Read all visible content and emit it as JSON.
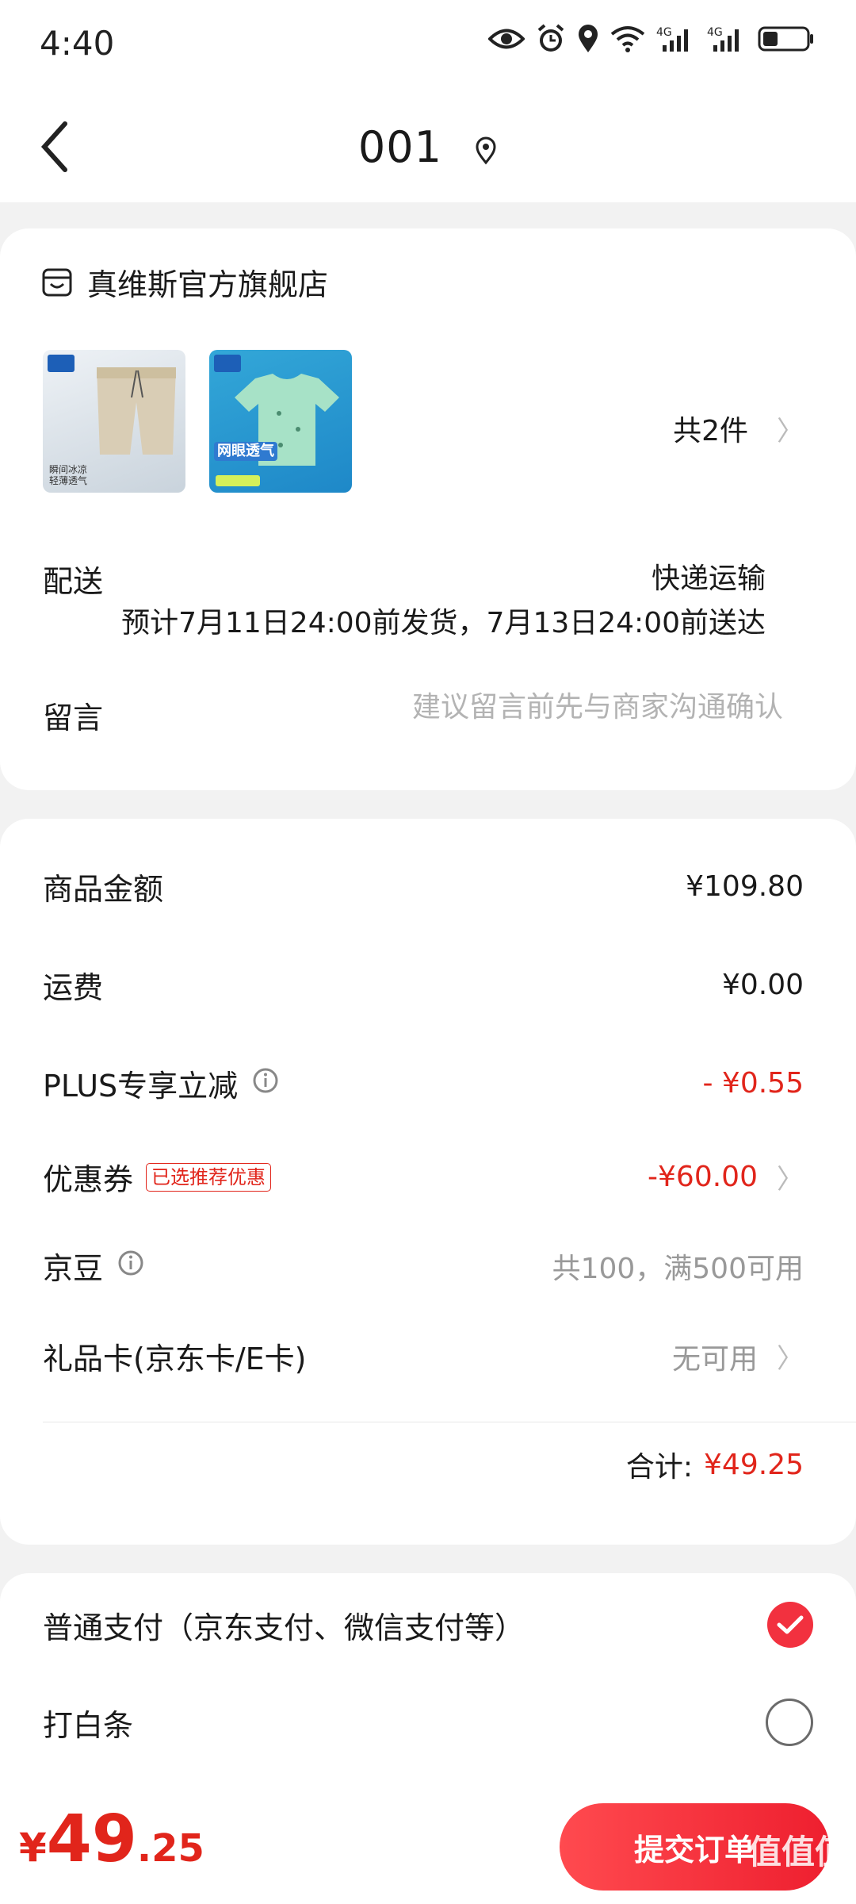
{
  "status_bar": {
    "time": "4:40",
    "network": "4G"
  },
  "nav": {
    "title": "001"
  },
  "store": {
    "name": "真维斯官方旗舰店"
  },
  "items": {
    "thumb1_caption": "瞬间冰凉\n轻薄透气",
    "thumb2_tag": "网眼透气",
    "count_label": "共2件"
  },
  "delivery": {
    "label": "配送",
    "method": "快递运输",
    "eta": "预计7月11日24:00前发货，7月13日24:00前送达"
  },
  "message": {
    "label": "留言",
    "placeholder": "建议留言前先与商家沟通确认"
  },
  "summary": {
    "goods_label": "商品金额",
    "goods_value": "¥109.80",
    "shipping_label": "运费",
    "shipping_value": "¥0.00",
    "plus_label": "PLUS专享立减",
    "plus_value": "- ¥0.55",
    "coupon_label": "优惠券",
    "coupon_badge": "已选推荐优惠",
    "coupon_value": "-¥60.00",
    "jingdou_label": "京豆",
    "jingdou_value": "共100，满500可用",
    "giftcard_label": "礼品卡(京东卡/E卡)",
    "giftcard_value": "无可用",
    "total_label": "合计:",
    "total_value": "¥49.25"
  },
  "payment": {
    "option1": "普通支付（京东支付、微信支付等）",
    "option2": "打白条",
    "selected": "option1"
  },
  "bottom": {
    "price_yen": "¥",
    "price_int": "49",
    "price_dec": ".25",
    "submit_label": "提交订单",
    "watermark": "值值值"
  },
  "colors": {
    "accent": "#e1251b",
    "button": "#f2313f"
  }
}
